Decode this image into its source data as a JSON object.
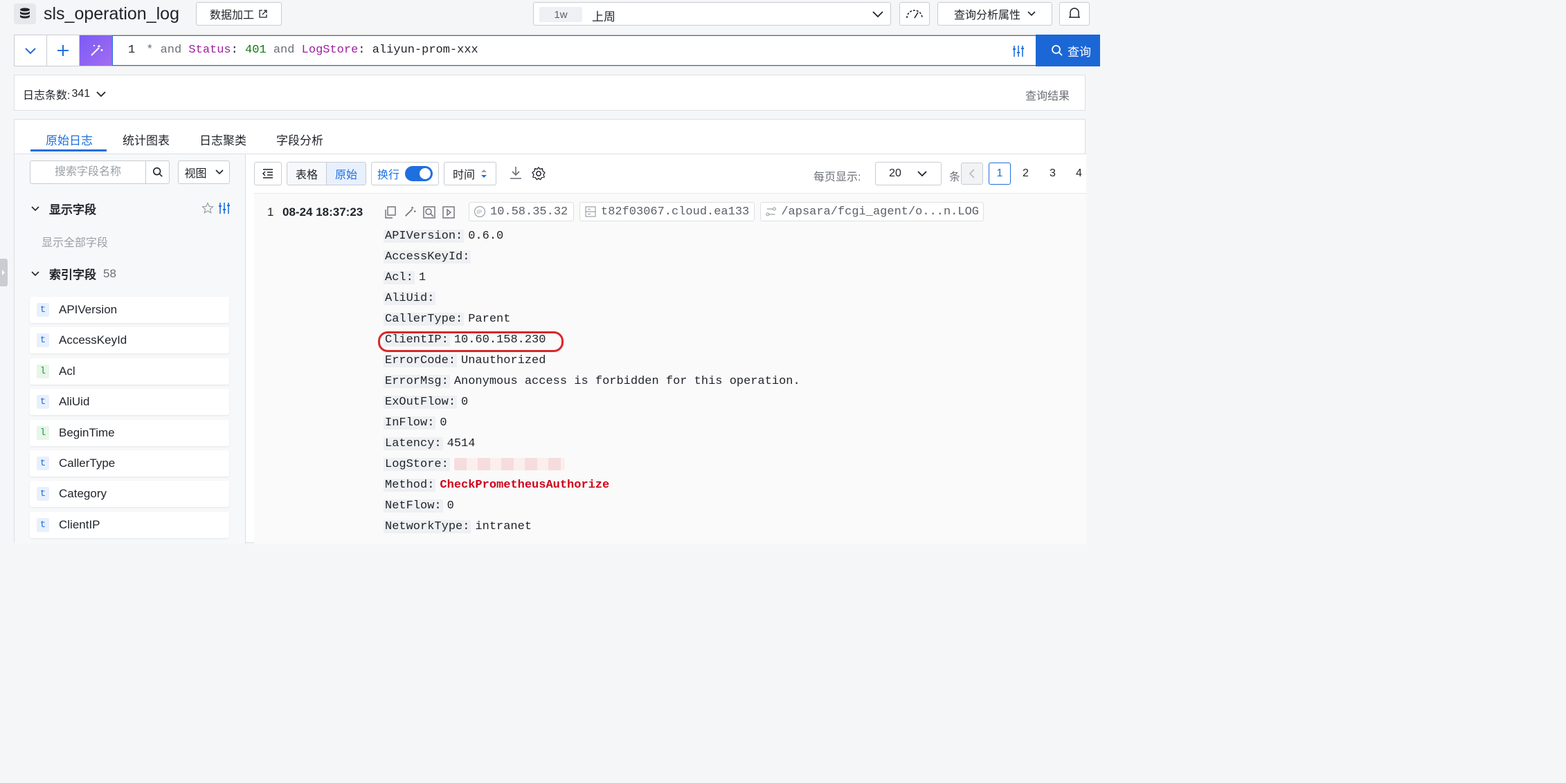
{
  "header": {
    "logstore_title": "sls_operation_log",
    "data_process_label": "数据加工",
    "time_range_chip": "1w",
    "time_range_label": "上周",
    "query_attributes_label": "查询分析属性"
  },
  "query": {
    "line_number": "1",
    "tokens": [
      {
        "text": "*",
        "kind": "and"
      },
      {
        "text": "and",
        "kind": "and"
      },
      {
        "text": "Status",
        "kind": "field"
      },
      {
        "text": ":",
        "kind": "val"
      },
      {
        "text": "401",
        "kind": "num"
      },
      {
        "text": "and",
        "kind": "and"
      },
      {
        "text": "LogStore",
        "kind": "field"
      },
      {
        "text": ":",
        "kind": "val"
      },
      {
        "text": "aliyun-prom-xxx",
        "kind": "val"
      }
    ],
    "search_label": "查询"
  },
  "summary": {
    "count_label": "日志条数:",
    "count_value": "341",
    "result_label": "查询结果"
  },
  "tabs": [
    "原始日志",
    "统计图表",
    "日志聚类",
    "字段分析"
  ],
  "sidebar": {
    "search_placeholder": "搜索字段名称",
    "view_label": "视图",
    "display_fields_label": "显示字段",
    "show_all_label": "显示全部字段",
    "index_fields_label": "索引字段",
    "index_fields_count": "58",
    "fields": [
      {
        "type": "t",
        "name": "APIVersion"
      },
      {
        "type": "t",
        "name": "AccessKeyId"
      },
      {
        "type": "l",
        "name": "Acl"
      },
      {
        "type": "t",
        "name": "AliUid"
      },
      {
        "type": "l",
        "name": "BeginTime"
      },
      {
        "type": "t",
        "name": "CallerType"
      },
      {
        "type": "t",
        "name": "Category"
      },
      {
        "type": "t",
        "name": "ClientIP"
      }
    ]
  },
  "toolbar": {
    "table_label": "表格",
    "raw_label": "原始",
    "wrap_label": "换行",
    "time_label": "时间",
    "per_page_label": "每页显示:",
    "per_page_value": "20",
    "per_page_suffix": "条",
    "pages": [
      "1",
      "2",
      "3",
      "4"
    ],
    "current_page": "1"
  },
  "log": {
    "index": "1",
    "time": "08-24 18:37:23",
    "ip": "10.58.35.32",
    "host": "t82f03067.cloud.ea133",
    "path": "/apsara/fcgi_agent/o...n.LOG",
    "entries": [
      {
        "key": "APIVersion:",
        "value": "0.6.0"
      },
      {
        "key": "AccessKeyId:",
        "value": ""
      },
      {
        "key": "Acl:",
        "value": "1"
      },
      {
        "key": "AliUid:",
        "value": ""
      },
      {
        "key": "CallerType:",
        "value": "Parent"
      },
      {
        "key": "ClientIP:",
        "value": "10.60.158.230"
      },
      {
        "key": "ErrorCode:",
        "value": "Unauthorized"
      },
      {
        "key": "ErrorMsg:",
        "value": "Anonymous access is forbidden for this operation."
      },
      {
        "key": "ExOutFlow:",
        "value": "0"
      },
      {
        "key": "InFlow:",
        "value": "0"
      },
      {
        "key": "Latency:",
        "value": "4514"
      },
      {
        "key": "LogStore:",
        "value": ""
      },
      {
        "key": "Method:",
        "value": "CheckPrometheusAuthorize"
      },
      {
        "key": "NetFlow:",
        "value": "0"
      },
      {
        "key": "NetworkType:",
        "value": "intranet"
      }
    ],
    "highlight_key": "ClientIP:",
    "method_color": "#d0021b"
  },
  "colors": {
    "accent": "#1f6fde",
    "highlight_ring": "#d9272a",
    "method": "#d0021b"
  }
}
